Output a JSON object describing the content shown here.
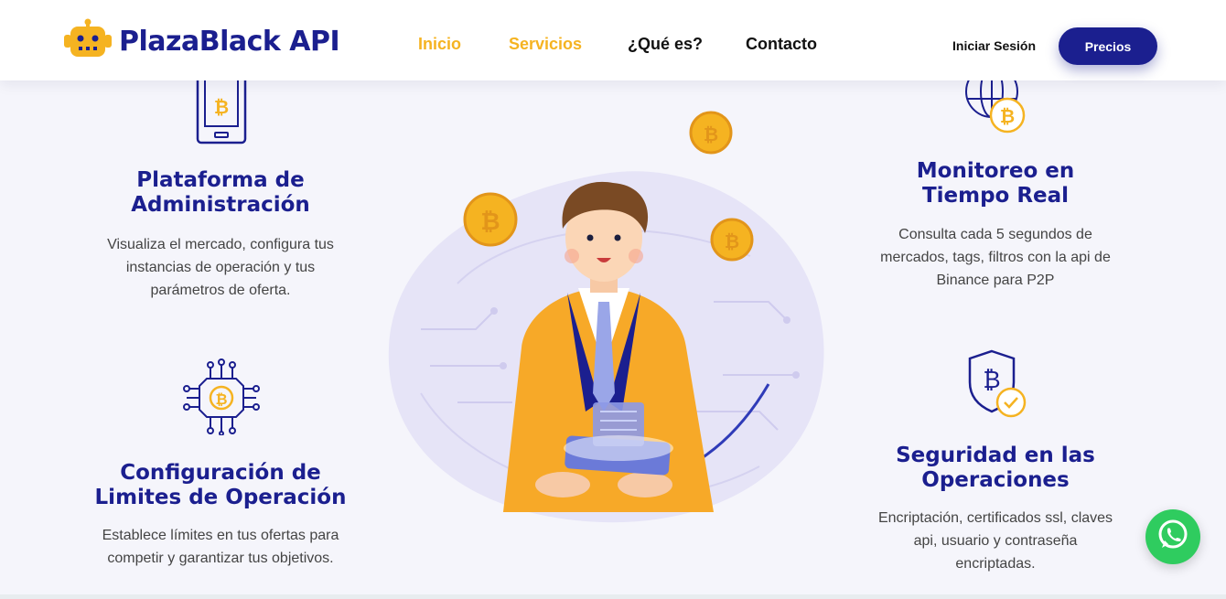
{
  "nav": {
    "brand": "PlazaBlack API",
    "links": [
      "Inicio",
      "Servicios",
      "¿Qué es?",
      "Contacto"
    ],
    "login": "Iniciar Sesión",
    "cta": "Precios"
  },
  "features": {
    "plataforma": {
      "title_line1": "Plataforma de",
      "title_line2": "Administración",
      "desc_line1": "Visualiza el mercado, configura tus",
      "desc_line2": "instancias de operación y tus",
      "desc_line3": "parámetros de oferta."
    },
    "configuracion": {
      "title_line1": "Configuración de",
      "title_line2": "Limites de Operación",
      "desc_line1": "Establece límites en tus ofertas para",
      "desc_line2": "competir y garantizar tus objetivos."
    },
    "monitoreo": {
      "title_line1": "Monitoreo en",
      "title_line2": "Tiempo Real",
      "desc_line1": "Consulta cada 5 segundos de",
      "desc_line2": "mercados, tags, filtros con la api de",
      "desc_line3": "Binance para P2P"
    },
    "seguridad": {
      "title_line1": "Seguridad en las",
      "title_line2": "Operaciones",
      "desc_line1": "Encriptación, certificados ssl, claves",
      "desc_line2": "api, usuario y contraseña",
      "desc_line3": "encriptadas."
    }
  },
  "colors": {
    "navy": "#1b1f8f",
    "gold": "#f5b321",
    "whatsapp": "#2fcc5f"
  },
  "icons": [
    "robot-logo-icon",
    "phone-bitcoin-icon",
    "globe-bitcoin-icon",
    "network-bitcoin-icon",
    "shield-bitcoin-icon",
    "whatsapp-icon"
  ]
}
